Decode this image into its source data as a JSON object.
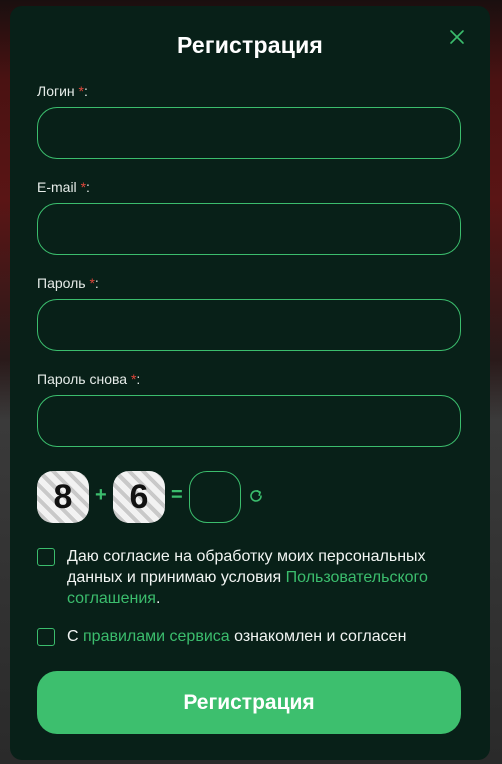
{
  "modal": {
    "title": "Регистрация",
    "close_icon": "close-icon"
  },
  "fields": {
    "login": {
      "label": "Логин",
      "required_mark": "*",
      "suffix": ":",
      "value": ""
    },
    "email": {
      "label": "E-mail",
      "required_mark": "*",
      "suffix": ":",
      "value": ""
    },
    "password": {
      "label": "Пароль",
      "required_mark": "*",
      "suffix": ":",
      "value": ""
    },
    "password_repeat": {
      "label": "Пароль снова",
      "required_mark": "*",
      "suffix": ":",
      "value": ""
    }
  },
  "captcha": {
    "first": "8",
    "operator": "+",
    "second": "6",
    "equals": "=",
    "answer": "",
    "refresh_icon": "refresh-icon"
  },
  "consent": {
    "personal_data_text": "Даю согласие на обработку моих персональных данных и принимаю условия ",
    "personal_data_link": "Пользовательского соглашения",
    "personal_data_end": ".",
    "rules_prefix": "С ",
    "rules_link": "правилами сервиса",
    "rules_suffix": " ознакомлен и согласен"
  },
  "submit": {
    "label": "Регистрация"
  },
  "colors": {
    "accent": "#3bbd6d",
    "background": "#082018",
    "required": "#e0463a"
  }
}
